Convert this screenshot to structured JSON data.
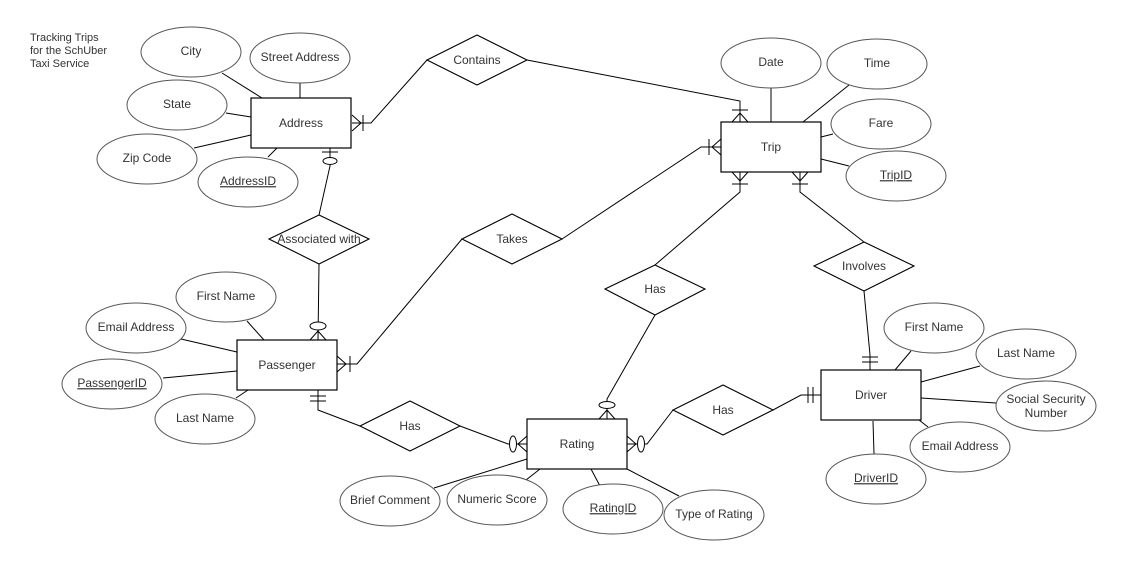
{
  "title": "Tracking Trips\nfor the SchUber\nTaxi Service",
  "entities": {
    "address": "Address",
    "trip": "Trip",
    "passenger": "Passenger",
    "rating": "Rating",
    "driver": "Driver"
  },
  "relationships": {
    "contains": "Contains",
    "associated_with": "Associated with",
    "takes": "Takes",
    "trip_has_rating": "Has",
    "involves": "Involves",
    "passenger_has_rating": "Has",
    "driver_has_rating": "Has"
  },
  "attributes": {
    "address": [
      {
        "label": "City",
        "key": false
      },
      {
        "label": "Street Address",
        "key": false
      },
      {
        "label": "State",
        "key": false
      },
      {
        "label": "Zip Code",
        "key": false
      },
      {
        "label": "AddressID",
        "key": true
      }
    ],
    "trip": [
      {
        "label": "Date",
        "key": false
      },
      {
        "label": "Time",
        "key": false
      },
      {
        "label": "Fare",
        "key": false
      },
      {
        "label": "TripID",
        "key": true
      }
    ],
    "passenger": [
      {
        "label": "First Name",
        "key": false
      },
      {
        "label": "Email Address",
        "key": false
      },
      {
        "label": "PassengerID",
        "key": true
      },
      {
        "label": "Last Name",
        "key": false
      }
    ],
    "rating": [
      {
        "label": "Brief Comment",
        "key": false
      },
      {
        "label": "Numeric Score",
        "key": false
      },
      {
        "label": "RatingID",
        "key": true
      },
      {
        "label": "Type of Rating",
        "key": false
      }
    ],
    "driver": [
      {
        "label": "First Name",
        "key": false
      },
      {
        "label": "Last Name",
        "key": false
      },
      {
        "label": "Social Security",
        "label2": "Number",
        "key": false
      },
      {
        "label": "Email Address",
        "key": false
      },
      {
        "label": "DriverID",
        "key": true
      }
    ]
  }
}
